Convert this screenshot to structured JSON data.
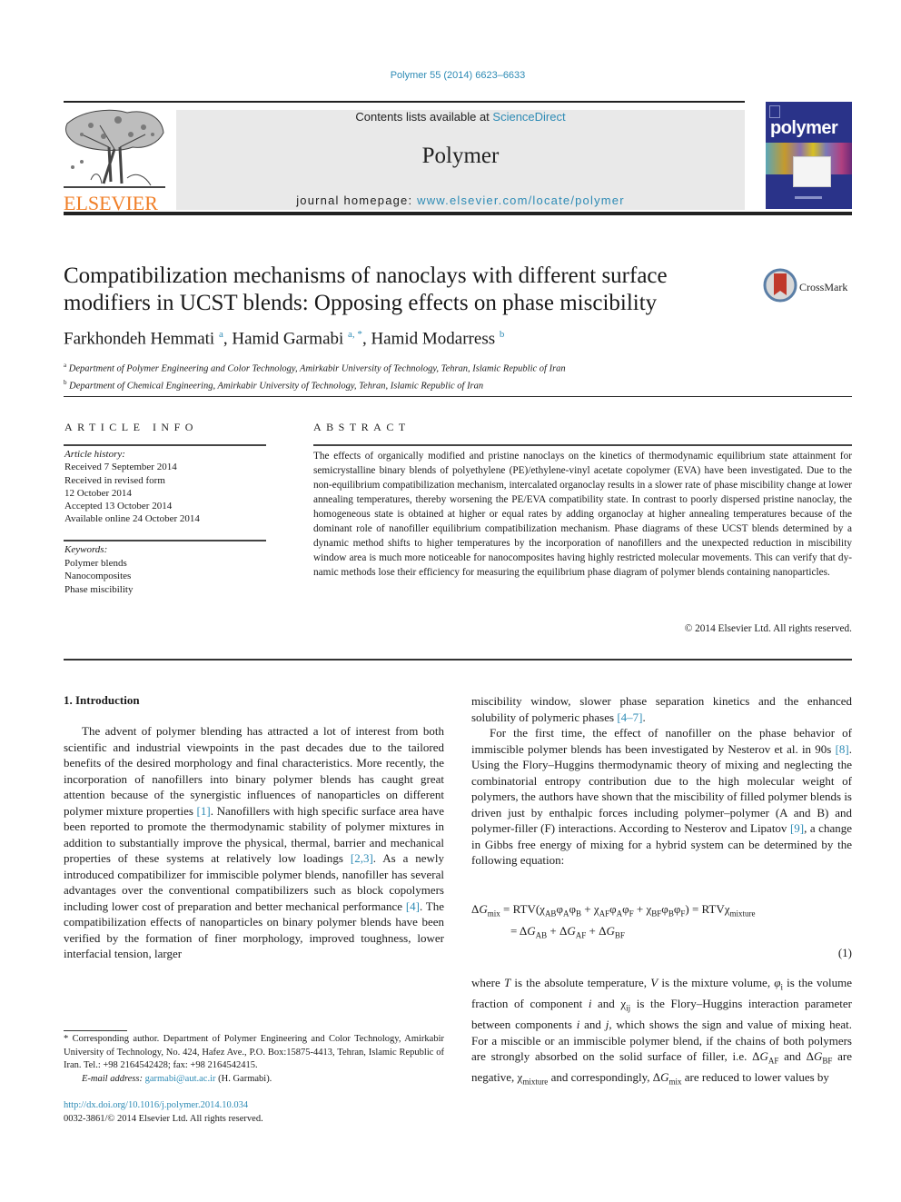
{
  "header": {
    "citation": "Polymer 55 (2014) 6623–6633",
    "publisher_name": "ELSEVIER",
    "contents_prefix": "Contents lists available at ",
    "contents_link": "ScienceDirect",
    "journal_name": "Polymer",
    "homepage_prefix": "journal homepage: ",
    "homepage_link": "www.elsevier.com/locate/polymer",
    "cover_title": "polymer",
    "colors": {
      "link": "#2e8bb5",
      "elsevier_orange": "#f07e26",
      "cover_blue": "#2a3389",
      "banner_gray": "#e9e9e9"
    }
  },
  "article": {
    "title": "Compatibilization mechanisms of nanoclays with different surface modifiers in UCST blends: Opposing effects on phase miscibility",
    "crossmark_label": "CrossMark",
    "authors": [
      {
        "name": "Farkhondeh Hemmati",
        "sup": "a"
      },
      {
        "name": "Hamid Garmabi",
        "sup": "a, *"
      },
      {
        "name": "Hamid Modarress",
        "sup": "b"
      }
    ],
    "affiliations": [
      {
        "mark": "a",
        "text": "Department of Polymer Engineering and Color Technology, Amirkabir University of Technology, Tehran, Islamic Republic of Iran"
      },
      {
        "mark": "b",
        "text": "Department of Chemical Engineering, Amirkabir University of Technology, Tehran, Islamic Republic of Iran"
      }
    ]
  },
  "article_info": {
    "heading": "ARTICLE INFO",
    "history_label": "Article history:",
    "history": [
      "Received 7 September 2014",
      "Received in revised form",
      "12 October 2014",
      "Accepted 13 October 2014",
      "Available online 24 October 2014"
    ],
    "keywords_label": "Keywords:",
    "keywords": [
      "Polymer blends",
      "Nanocomposites",
      "Phase miscibility"
    ]
  },
  "abstract": {
    "heading": "ABSTRACT",
    "text": "The effects of organically modified and pristine nanoclays on the kinetics of thermodynamic equilibrium state attainment for semicrystalline binary blends of polyethylene (PE)/ethylene-vinyl acetate copolymer (EVA) have been investigated. Due to the non-equilibrium compatibilization mechanism, intercalated organoclay results in a slower rate of phase miscibility change at lower annealing temperatures, thereby worsening the PE/EVA compatibility state. In contrast to poorly dispersed pristine nanoclay, the ho­mogeneous state is obtained at higher or equal rates by adding organoclay at higher annealing tem­peratures because of the dominant role of nanofiller equilibrium compatibilization mechanism. Phase diagrams of these UCST blends determined by a dynamic method shifts to higher temperatures by the incorporation of nanofillers and the unexpected reduction in miscibility window area is much more noticeable for nanocomposites having highly restricted molecular movements. This can verify that dy­namic methods lose their efficiency for measuring the equilibrium phase diagram of polymer blends containing nanoparticles.",
    "copyright": "© 2014 Elsevier Ltd. All rights reserved."
  },
  "body": {
    "section_heading": "1.  Introduction",
    "left_para": [
      {
        "t": "The advent of polymer blending has attracted a lot of interest from both scientific and industrial viewpoints in the past decades due to the tailored benefits of the desired morphology and final characteristics. More recently, the incorporation of nanofillers into binary polymer blends has caught great attention because of the synergistic influences of nanoparticles on different polymer mixture properties "
      },
      {
        "ref": "[1]"
      },
      {
        "t": ". Nanofillers with high specific surface area have been reported to promote the thermodynamic stability of polymer mixtures in addition to substantially improve the physical, thermal, barrier and mechanical properties of these systems at relatively low loadings "
      },
      {
        "ref": "[2,3]"
      },
      {
        "t": ". As a newly introduced compatibilizer for immiscible polymer blends, nanofiller has several advantages over the conventional compatibilizers such as block copolymers including lower cost of preparation and better mechanical perfor­mance "
      },
      {
        "ref": "[4]"
      },
      {
        "t": ". The compatibilization effects of nanoparticles on binary polymer blends have been verified by the formation of finer morphology, improved toughness, lower interfacial tension, larger"
      }
    ],
    "right_para1": [
      {
        "t": "miscibility window, slower phase separation kinetics and the enhanced solubility of polymeric phases "
      },
      {
        "ref": "[4–7]"
      },
      {
        "t": "."
      }
    ],
    "right_para2": [
      {
        "t": "For the first time, the effect of nanofiller on the phase behavior of immiscible polymer blends has been investigated by Nesterov et al. in 90s "
      },
      {
        "ref": "[8]"
      },
      {
        "t": ". Using the Flory–Huggins thermodynamic theory of mixing and neglecting the combinatorial entropy contribution due to the high molecular weight of polymers, the authors have shown that the miscibility of filled polymer blends is driven just by enthalpic forces including polymer–polymer (A and B) and polymer-filler (F) interactions. According to Nesterov and Lipatov "
      },
      {
        "ref": "[9]"
      },
      {
        "t": ", a change in Gibbs free energy of mixing for a hybrid system can be determined by the following equation:"
      }
    ],
    "equation": {
      "number": "(1)"
    },
    "footnote": {
      "corresponding": "* Corresponding author. Department of Polymer Engineering and Color Tech­nology, Amirkabir University of Technology, No. 424, Hafez Ave., P.O. Box:15875-4413, Tehran, Islamic Republic of Iran. Tel.: +98 2164542428; fax: +98 2164542415.",
      "email_label": "E-mail address:",
      "email": "garmabi@aut.ac.ir",
      "email_suffix": " (H. Garmabi)."
    },
    "doi": "http://dx.doi.org/10.1016/j.polymer.2014.10.034",
    "issn_line": "0032-3861/© 2014 Elsevier Ltd. All rights reserved."
  }
}
